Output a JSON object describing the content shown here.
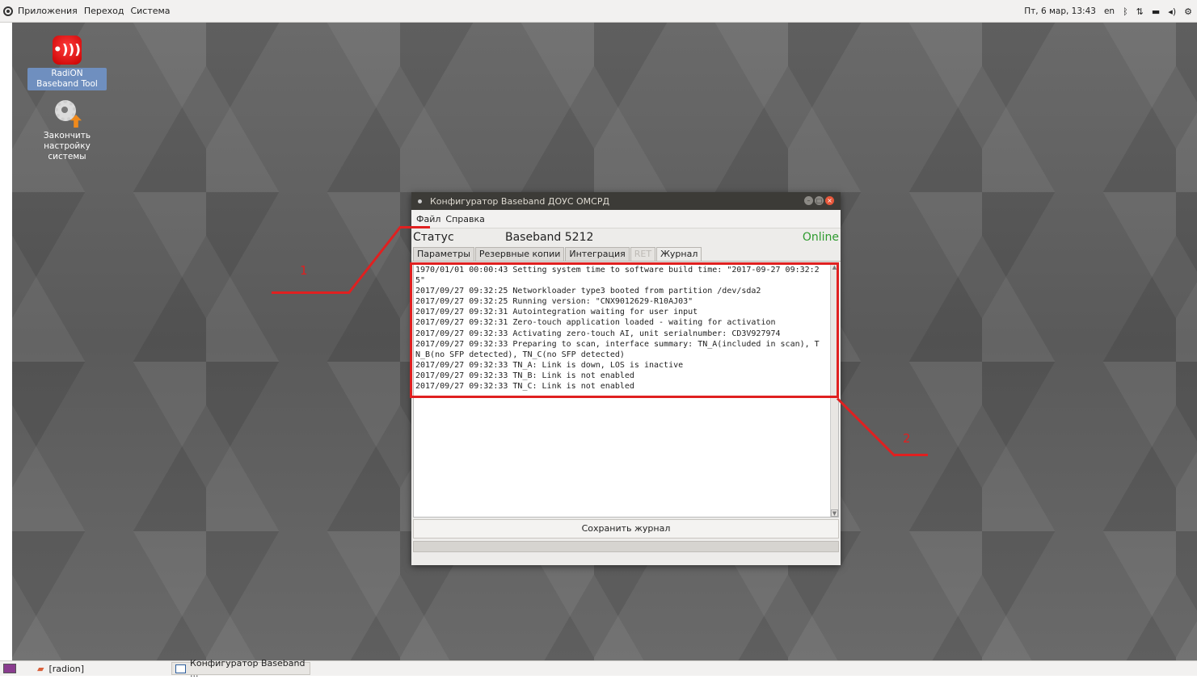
{
  "top_panel": {
    "menus": [
      "Приложения",
      "Переход",
      "Система"
    ],
    "clock": "Пт, 6 мар, 13:43",
    "keyboard_layout": "en",
    "icons": [
      "bluetooth-icon",
      "network-icon",
      "battery-icon",
      "volume-icon",
      "settings-icon"
    ]
  },
  "desktop": {
    "icons": [
      {
        "label": "RadiON Baseband Tool",
        "icon": "radion-icon"
      },
      {
        "label": "Закончить настройку системы",
        "icon": "gear-update-icon"
      }
    ]
  },
  "window": {
    "title": "Конфигуратор Baseband ДОУС ОМСРД",
    "menu": [
      "Файл",
      "Справка"
    ],
    "status_label": "Статус",
    "device_name": "Baseband 5212",
    "status_value": "Online",
    "status_color": "#2e9b2e",
    "tabs": [
      {
        "label": "Параметры",
        "state": "normal"
      },
      {
        "label": "Резервные копии",
        "state": "normal"
      },
      {
        "label": "Интеграция",
        "state": "normal"
      },
      {
        "label": "RET",
        "state": "disabled"
      },
      {
        "label": "Журнал",
        "state": "active"
      }
    ],
    "log_lines": [
      "1970/01/01 00:00:43 Setting system time to software build time: \"2017-09-27 09:32:2",
      "5\"",
      "2017/09/27 09:32:25 Networkloader type3 booted from partition /dev/sda2",
      "2017/09/27 09:32:25 Running version: \"CNX9012629-R10AJ03\"",
      "2017/09/27 09:32:31 Autointegration waiting for user input",
      "2017/09/27 09:32:31 Zero-touch application loaded - waiting for activation",
      "2017/09/27 09:32:33 Activating zero-touch AI, unit serialnumber: CD3V927974",
      "2017/09/27 09:32:33 Preparing to scan, interface summary: TN_A(included in scan), T",
      "N_B(no SFP detected), TN_C(no SFP detected)",
      "2017/09/27 09:32:33 TN_A: Link is down, LOS is inactive",
      "2017/09/27 09:32:33 TN_B: Link is not enabled",
      "2017/09/27 09:32:33 TN_C: Link is not enabled"
    ],
    "save_button": "Сохранить журнал"
  },
  "annotations": {
    "label1": "1",
    "label2": "2",
    "color": "#e02020"
  },
  "taskbar": {
    "items": [
      "[radion]",
      "Конфигуратор Baseband ..."
    ]
  }
}
